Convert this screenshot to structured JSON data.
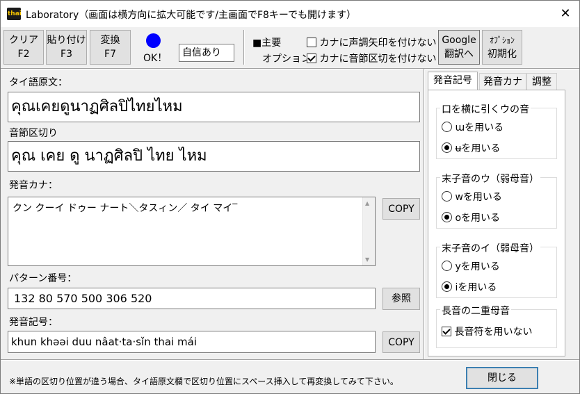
{
  "window": {
    "title": "Laboratory（画面は横方向に拡大可能です/主画面でF8キーでも開けます）",
    "icon_text": "thai",
    "close_glyph": "✕"
  },
  "toolbar": {
    "clear_label": "クリア",
    "clear_key": "F2",
    "paste_label": "貼り付け",
    "paste_key": "F3",
    "convert_label": "変換",
    "convert_key": "F7",
    "status_color": "#0000ff",
    "status_text": "OK！",
    "confidence": "自信あり",
    "main_label": "■主要",
    "options_label": "オプション",
    "no_tone_arrow_label": "カナに声調矢印を付けない",
    "no_tone_arrow_checked": false,
    "no_syllable_sep_label": "カナに音節区切を付けない",
    "no_syllable_sep_checked": true,
    "google_line1": "Google",
    "google_line2": "翻訳へ",
    "init_line1": "ｵﾌﾟｼｮﾝ",
    "init_line2": "初期化"
  },
  "main": {
    "thai_original_label": "タイ語原文：",
    "thai_original_value": "คุณเคยดูนาฏศิลปิไทยไหม",
    "syllable_label": "音節区切り",
    "syllable_value": "คุณ เคย ดู นาฏศิลปิ ไทย ไหม",
    "kana_label": "発音カナ：",
    "kana_value": "クン クーイ ドゥー ナート＼タスィン／ タイ マイ‾",
    "copy_label": "COPY",
    "pattern_label": "パターン番号：",
    "pattern_value": "132 80 570 500 306 520",
    "ref_label": "参照",
    "phonetic_label": "発音記号：",
    "phonetic_value": "khun khəəi duu nâat·ta·sǐn thai mái",
    "copy2_label": "COPY"
  },
  "tabs": [
    {
      "label": "発音記号",
      "active": true
    },
    {
      "label": "発音カナ",
      "active": false
    },
    {
      "label": "調整",
      "active": false
    }
  ],
  "settings": {
    "group1": {
      "title": "口を横に引くウの音",
      "opt1": "ɯを用いる",
      "opt1_selected": false,
      "opt2": "ʉを用いる",
      "opt2_selected": true
    },
    "group2": {
      "title": "末子音のウ（弱母音）",
      "opt1": "wを用いる",
      "opt1_selected": false,
      "opt2": "oを用いる",
      "opt2_selected": true
    },
    "group3": {
      "title": "末子音のイ（弱母音）",
      "opt1": "yを用いる",
      "opt1_selected": false,
      "opt2": "iを用いる",
      "opt2_selected": true
    },
    "group4": {
      "title": "長音の二重母音",
      "check_label": "長音符を用いない",
      "check_checked": true
    }
  },
  "footer": {
    "note": "※単語の区切り位置が違う場合、タイ語原文欄で区切り位置にスペース挿入して再変換してみて下さい。",
    "close_label": "閉じる"
  }
}
